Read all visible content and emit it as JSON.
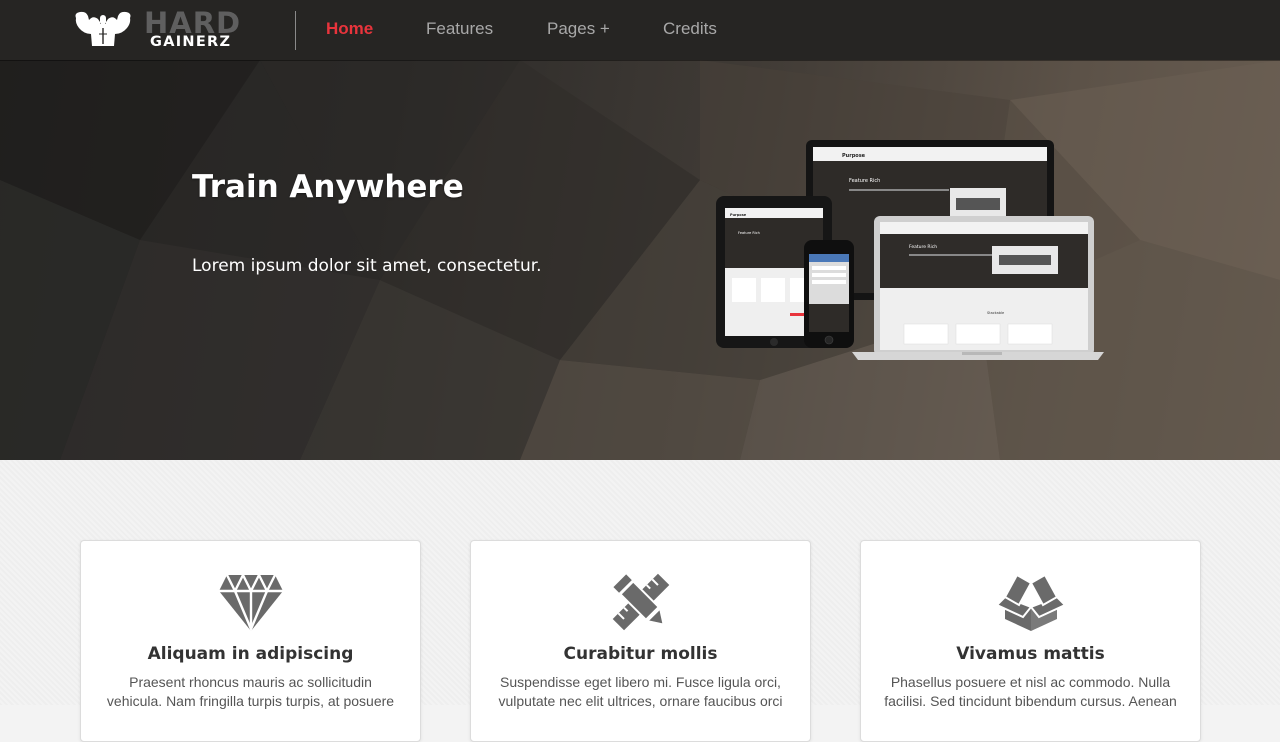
{
  "brand": {
    "line1": "HARD",
    "line2": "GAINERZ"
  },
  "nav": {
    "items": [
      {
        "label": "Home",
        "active": true
      },
      {
        "label": "Features",
        "active": false
      },
      {
        "label": "Pages +",
        "active": false
      },
      {
        "label": "Credits",
        "active": false
      }
    ]
  },
  "hero": {
    "title": "Train Anywhere",
    "subtitle": "Lorem ipsum dolor sit amet, consectetur.",
    "devices_image": {
      "brand": "Purpose",
      "heading": "Feature Rich",
      "section_label": "Stackable"
    }
  },
  "features": [
    {
      "icon": "diamond-icon",
      "title": "Aliquam in adipiscing",
      "text": "Praesent rhoncus mauris ac sollicitudin vehicula. Nam fringilla turpis turpis, at posuere"
    },
    {
      "icon": "pencil-ruler-icon",
      "title": "Curabitur mollis",
      "text": "Suspendisse eget libero mi. Fusce ligula orci, vulputate nec elit ultrices, ornare faucibus orci"
    },
    {
      "icon": "open-box-icon",
      "title": "Vivamus mattis",
      "text": "Phasellus posuere et nisl ac commodo. Nulla facilisi. Sed tincidunt bibendum cursus. Aenean"
    }
  ],
  "colors": {
    "navbar_bg": "#262523",
    "nav_active": "#e8343c",
    "nav_text": "#a8a8a8",
    "icon_gray": "#6a6a6a"
  }
}
